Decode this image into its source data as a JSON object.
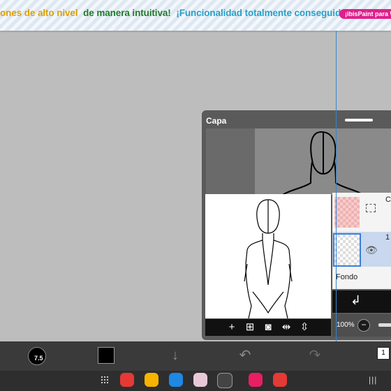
{
  "ad": {
    "segments": [
      {
        "text": "ones de alto nivel",
        "color": "#e0a000"
      },
      {
        "text": "de manera intuitiva!",
        "color": "#1f7a2a"
      },
      {
        "text": "¡Funcionalidad totalmente conseguida!",
        "color": "#2aa0c8"
      }
    ],
    "button_label": "¡ibisPaint para Wi"
  },
  "panel": {
    "title": "Capa",
    "layers": [
      {
        "label": "C"
      },
      {
        "label": "1"
      }
    ],
    "background_label": "Fondo",
    "opacity": "100%"
  },
  "toolbar": {
    "brush_size": "7.5",
    "brush_color": "#000000",
    "layers_count": "1"
  },
  "colors": {
    "accent": "#3b82d4",
    "panel_bg": "#5a5a5a",
    "toolbar_bg": "#3a3a3a"
  },
  "icons": [
    "add-layer-icon",
    "add-layer-copy-icon",
    "camera-icon",
    "flip-horizontal-icon",
    "flip-vertical-icon",
    "merge-down-icon",
    "eye-icon",
    "down-arrow-icon",
    "undo-icon",
    "redo-icon"
  ]
}
